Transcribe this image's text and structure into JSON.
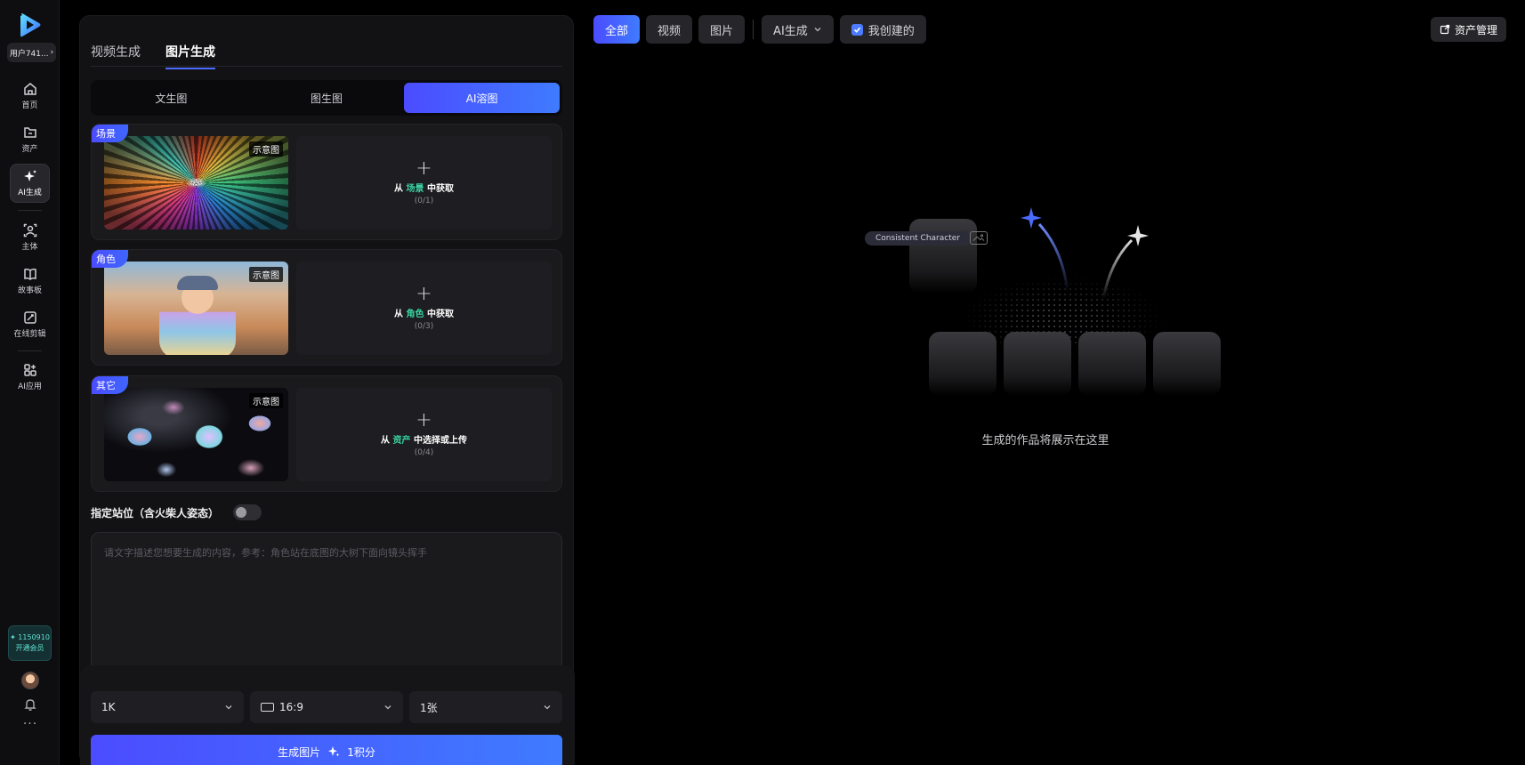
{
  "rail": {
    "user": "用户741...",
    "items": [
      {
        "label": "首页",
        "icon": "home-icon"
      },
      {
        "label": "资产",
        "icon": "folder-icon"
      },
      {
        "label": "AI生成",
        "icon": "sparkle-icon"
      },
      {
        "label": "主体",
        "icon": "subject-icon"
      },
      {
        "label": "故事板",
        "icon": "book-icon"
      },
      {
        "label": "在线剪辑",
        "icon": "edit-icon"
      },
      {
        "label": "AI应用",
        "icon": "apps-icon"
      }
    ],
    "points": "✦ 1150910",
    "vip_label": "开通会员"
  },
  "panel": {
    "modes": [
      "视频生成",
      "图片生成"
    ],
    "active_mode": "图片生成",
    "subtabs": [
      "文生图",
      "图生图",
      "AI溶图"
    ],
    "active_subtab": "AI溶图",
    "cards": [
      {
        "tag": "场景",
        "thumb_label": "示意图",
        "prefix": "从 ",
        "highlight": "场景",
        "suffix": " 中获取",
        "count": "(0/1)"
      },
      {
        "tag": "角色",
        "thumb_label": "示意图",
        "prefix": "从 ",
        "highlight": "角色",
        "suffix": " 中获取",
        "count": "(0/3)"
      },
      {
        "tag": "其它",
        "thumb_label": "示意图",
        "prefix": "从 ",
        "highlight": "资产",
        "suffix": " 中选择或上传",
        "count": "(0/4)"
      }
    ],
    "pose_label": "指定站位（含火柴人姿态）",
    "pose_enabled": false,
    "prompt_placeholder": "请文字描述您想要生成的内容，参考：角色站在底图的大树下面向镜头挥手",
    "resolution": "1K",
    "ratio": "16:9",
    "quantity": "1张",
    "generate_label": "生成图片",
    "cost_label": "1积分"
  },
  "topbar": {
    "filters": [
      "全部",
      "视频",
      "图片"
    ],
    "active_filter": "全部",
    "source_select": "AI生成",
    "mine_label": "我创建的",
    "mine_checked": true,
    "asset_button": "资产管理"
  },
  "empty": {
    "chip": "Consistent Character",
    "message": "生成的作品将展示在这里"
  },
  "colors": {
    "accent": "#4b4cff",
    "accent2": "#3f7bff",
    "highlight": "#38d39f",
    "vip": "#5fe3d2"
  }
}
